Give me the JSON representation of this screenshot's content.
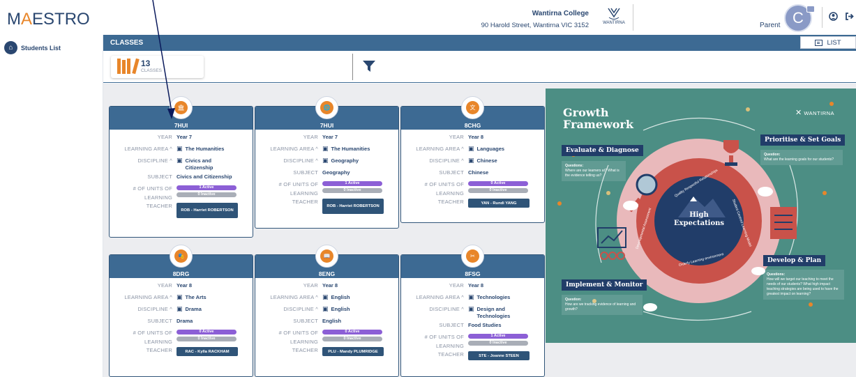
{
  "app": {
    "logo_prefix": "M",
    "logo_a": "A",
    "logo_suffix": "ESTRO"
  },
  "school": {
    "name": "Wantirna College",
    "address": "90 Harold Street, Wantirna VIC 3152",
    "crest_text": "WANTIRNA"
  },
  "user": {
    "role_label": "Parent",
    "avatar_letter": "C"
  },
  "sidebar": {
    "items": [
      {
        "label": "Students List",
        "icon": "home-icon"
      }
    ]
  },
  "section": {
    "title": "CLASSES",
    "list_button": "LIST"
  },
  "summary": {
    "count": "13",
    "label": "CLASSES"
  },
  "card_labels": {
    "year": "YEAR",
    "learning_area": "LEARNING AREA ^",
    "discipline": "DISCIPLINE ^",
    "subject": "SUBJECT",
    "units_1": "# OF UNITS OF",
    "units_2": "LEARNING",
    "teacher": "TEACHER"
  },
  "classes": [
    {
      "code": "7HUI",
      "year": "Year 7",
      "learning_area": "The Humanities",
      "discipline": "Civics and Citizenship",
      "subject": "Civics and Citizenship",
      "active": "1 Active",
      "inactive": "0 Inactive",
      "teacher": "ROB - Harriet ROBERTSON"
    },
    {
      "code": "7HUI",
      "year": "Year 7",
      "learning_area": "The Humanities",
      "discipline": "Geography",
      "subject": "Geography",
      "active": "1 Active",
      "inactive": "0 Inactive",
      "teacher": "ROB - Harriet ROBERTSON"
    },
    {
      "code": "8CHG",
      "year": "Year 8",
      "learning_area": "Languages",
      "discipline": "Chinese",
      "subject": "Chinese",
      "active": "0 Active",
      "inactive": "0 Inactive",
      "teacher": "YAN - Rundi YANG"
    },
    {
      "code": "8DRG",
      "year": "Year 8",
      "learning_area": "The Arts",
      "discipline": "Drama",
      "subject": "Drama",
      "active": "0 Active",
      "inactive": "0 Inactive",
      "teacher": "RAC - Kylla RACKHAM"
    },
    {
      "code": "8ENG",
      "year": "Year 8",
      "learning_area": "English",
      "discipline": "English",
      "subject": "English",
      "active": "0 Active",
      "inactive": "0 Inactive",
      "teacher": "PLU - Mandy PLUMRIDGE"
    },
    {
      "code": "8FSG",
      "year": "Year 8",
      "learning_area": "Technologies",
      "discipline": "Design and Technologies",
      "subject": "Food Studies",
      "active": "1 Active",
      "inactive": "0 Inactive",
      "teacher": "STE - Joanne STEEN"
    }
  ],
  "poster": {
    "title_1": "Growth",
    "title_2": "Framework",
    "logo_text": "WANTIRNA",
    "center_1": "High",
    "center_2": "Expectations",
    "ring_text_1": "Quality Respectful Relationships",
    "ring_text_2": "Student Centred Learning Model",
    "ring_text_3": "Orderly Learning environment",
    "ring_text_4": "Developmental Assessment",
    "stages": [
      {
        "title": "Evaluate & Diagnose",
        "q_label": "Questions:",
        "q": "Where are our learners at? What is the evidence telling us?"
      },
      {
        "title": "Prioritise & Set Goals",
        "q_label": "Question:",
        "q": "What are the learning goals for our students?"
      },
      {
        "title": "Implement & Monitor",
        "q_label": "Question:",
        "q": "How are we tracking evidence of learning and growth?"
      },
      {
        "title": "Develop & Plan",
        "q_label": "Questions:",
        "q": "How will we target our teaching to meet the needs of our students? What high impact teaching strategies are being used to have the greatest impact on learning?"
      }
    ]
  }
}
